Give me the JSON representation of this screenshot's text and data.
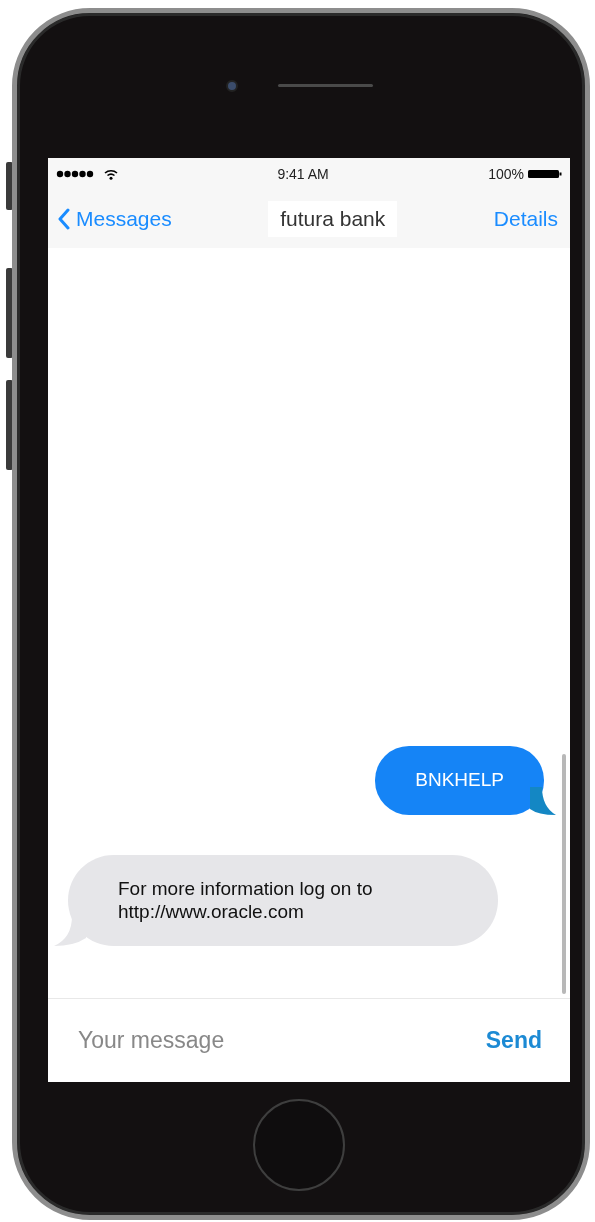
{
  "status_bar": {
    "time": "9:41 AM",
    "battery": "100%"
  },
  "nav": {
    "back": "Messages",
    "title": "futura bank",
    "action": "Details"
  },
  "messages": [
    {
      "kind": "sent",
      "text": "BNKHELP"
    },
    {
      "kind": "received",
      "text": "For more information log on to http://www.oracle.com"
    }
  ],
  "composer": {
    "placeholder": "Your message",
    "send": "Send"
  }
}
